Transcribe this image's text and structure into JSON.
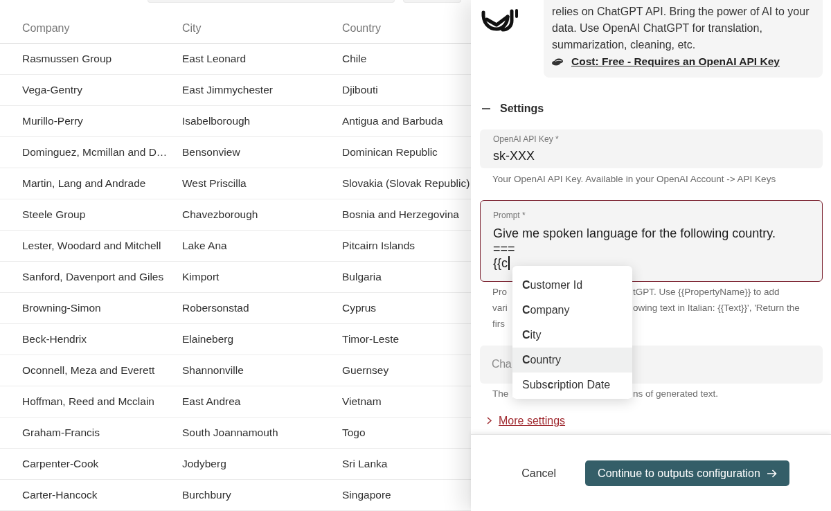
{
  "table": {
    "columns": [
      "Company",
      "City",
      "Country"
    ],
    "rows": [
      [
        "Rasmussen Group",
        "East Leonard",
        "Chile"
      ],
      [
        "Vega-Gentry",
        "East Jimmychester",
        "Djibouti"
      ],
      [
        "Murillo-Perry",
        "Isabelborough",
        "Antigua and Barbuda"
      ],
      [
        "Dominguez, Mcmillan and D…",
        "Bensonview",
        "Dominican Republic"
      ],
      [
        "Martin, Lang and Andrade",
        "West Priscilla",
        "Slovakia (Slovak Republic)"
      ],
      [
        "Steele Group",
        "Chavezborough",
        "Bosnia and Herzegovina"
      ],
      [
        "Lester, Woodard and Mitchell",
        "Lake Ana",
        "Pitcairn Islands"
      ],
      [
        "Sanford, Davenport and Giles",
        "Kimport",
        "Bulgaria"
      ],
      [
        "Browning-Simon",
        "Robersonstad",
        "Cyprus"
      ],
      [
        "Beck-Hendrix",
        "Elaineberg",
        "Timor-Leste"
      ],
      [
        "Oconnell, Meza and Everett",
        "Shannonville",
        "Guernsey"
      ],
      [
        "Hoffman, Reed and Mcclain",
        "East Andrea",
        "Vietnam"
      ],
      [
        "Graham-Francis",
        "South Joannamouth",
        "Togo"
      ],
      [
        "Carpenter-Cook",
        "Jodyberg",
        "Sri Lanka"
      ],
      [
        "Carter-Hancock",
        "Burchbury",
        "Singapore"
      ]
    ]
  },
  "panel": {
    "description": "relies on ChatGPT API. Bring the power of AI to your data. Use OpenAI ChatGPT for translation, summarization, cleaning, etc.",
    "cost_link": "Cost: Free - Requires an OpenAI API Key",
    "settings": {
      "title": "Settings",
      "expanded": true
    },
    "fields": [
      {
        "kind": "text",
        "label": "OpenAI API Key *",
        "value_lines": [
          "sk-XXX"
        ],
        "focused": false,
        "help": [
          {
            "left": "Your OpenAI API Key. Available in your OpenAI Account -> API Keys"
          }
        ]
      },
      {
        "kind": "textarea",
        "label": "Prompt *",
        "value_lines": [
          "Give me spoken language for the following country.",
          "===",
          "{{c"
        ],
        "focused": true,
        "help": [
          {
            "left": "Pro",
            "right": "tGPT. Use {{PropertyName}} to add"
          },
          {
            "left": "vari",
            "right": "owing text in Italian: {{Text}}', 'Return the"
          },
          {
            "left": "firs"
          }
        ]
      },
      {
        "kind": "text",
        "placeholder": "Cha",
        "focused": false,
        "help": [
          {
            "left": "The",
            "right": "ns of generated text."
          }
        ]
      }
    ],
    "more_settings": {
      "label": "More settings",
      "expanded": false
    },
    "autocomplete": {
      "items": [
        {
          "label": "**C**ustomer Id",
          "selected": false
        },
        {
          "label": "**C**ompany",
          "selected": false
        },
        {
          "label": "**C**ity",
          "selected": false
        },
        {
          "label": "**C**ountry",
          "selected": true
        },
        {
          "label": "Subs**c**ription Date",
          "selected": false
        }
      ]
    },
    "buttons": [
      {
        "kind": "text",
        "label": "Cancel"
      },
      {
        "kind": "primary",
        "label": "Continue to outputs configuration"
      }
    ]
  }
}
